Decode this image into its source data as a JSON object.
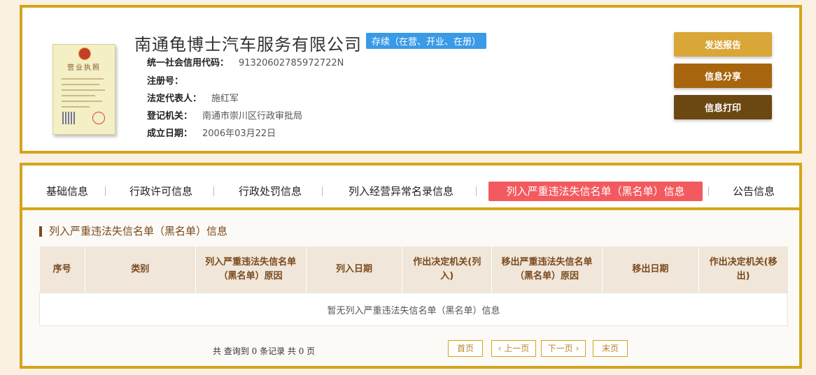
{
  "company": {
    "name": "南通龟博士汽车服务有限公司",
    "status": "存续（在营、开业、在册）"
  },
  "license": {
    "title": "营业执照"
  },
  "info": [
    {
      "label": "统一社会信用代码：",
      "value": "91320602785972722N"
    },
    {
      "label": "注册号：",
      "value": ""
    },
    {
      "label": "法定代表人：",
      "value": "施红军"
    },
    {
      "label": "登记机关：",
      "value": "南通市崇川区行政审批局"
    },
    {
      "label": "成立日期：",
      "value": "2006年03月22日"
    }
  ],
  "actions": [
    {
      "label": "发送报告",
      "color": "#d9a637"
    },
    {
      "label": "信息分享",
      "color": "#a7650d"
    },
    {
      "label": "信息打印",
      "color": "#6b4712"
    }
  ],
  "tabs": [
    {
      "label": "基础信息"
    },
    {
      "label": "行政许可信息"
    },
    {
      "label": "行政处罚信息"
    },
    {
      "label": "列入经营异常名录信息"
    },
    {
      "label": "列入严重违法失信名单（黑名单）信息",
      "active": true
    },
    {
      "label": "公告信息"
    }
  ],
  "section": {
    "title": "列入严重违法失信名单（黑名单）信息"
  },
  "table": {
    "headers": [
      "序号",
      "类别",
      "列入严重违法失信名单（黑名单）原因",
      "列入日期",
      "作出决定机关(列入)",
      "移出严重违法失信名单（黑名单）原因",
      "移出日期",
      "作出决定机关(移出)"
    ],
    "empty_text": "暂无列入严重违法失信名单（黑名单）信息"
  },
  "pager": {
    "summary": "共 查询到 0 条记录 共 0 页",
    "first": "首页",
    "prev": "上一页",
    "next": "下一页",
    "last": "末页"
  },
  "colors": {
    "accent_border": "#d4a51c",
    "active_tab": "#f35a5f",
    "badge": "#3a9ae6"
  }
}
